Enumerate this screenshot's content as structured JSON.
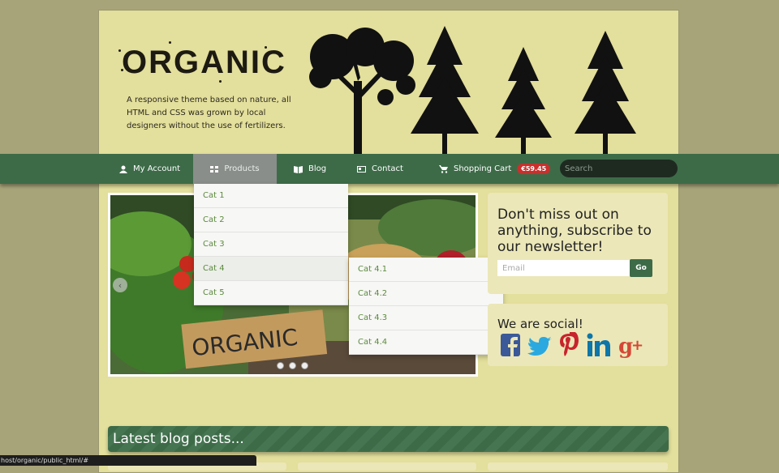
{
  "header": {
    "logo_text": "ORGANIC",
    "tagline": "A responsive theme based on nature, all HTML and CSS was grown by local designers without the use of fertilizers."
  },
  "nav": {
    "items": [
      {
        "label": "My Account",
        "icon": "user-icon"
      },
      {
        "label": "Products",
        "icon": "grid-icon"
      },
      {
        "label": "Blog",
        "icon": "book-icon"
      },
      {
        "label": "Contact",
        "icon": "card-icon"
      },
      {
        "label": "Shopping Cart",
        "icon": "cart-icon"
      }
    ],
    "cart_total": "€59.45",
    "search_placeholder": "Search"
  },
  "products_menu": [
    "Cat 1",
    "Cat 2",
    "Cat 3",
    "Cat 4",
    "Cat 5"
  ],
  "cat4_submenu": [
    "Cat 4.1",
    "Cat 4.2",
    "Cat 4.3",
    "Cat 4.4"
  ],
  "slider": {
    "sign_text": "ORGANIC"
  },
  "newsletter": {
    "title": "Don't miss out on anything, subscribe to our newsletter!",
    "email_placeholder": "Email",
    "go_label": "Go"
  },
  "social": {
    "title": "We are social!",
    "icons": [
      "facebook-icon",
      "twitter-icon",
      "pinterest-icon",
      "linkedin-icon",
      "google-plus-icon"
    ]
  },
  "blog": {
    "title": "Latest blog posts..."
  },
  "statusbar": {
    "url": "host/organic/public_html/#"
  },
  "colors": {
    "nav_green": "#3d6b48",
    "page_bg": "#e3df9c",
    "body_bg": "#a8a47a",
    "badge_red": "#c9302c",
    "menu_text": "#5b8a3d"
  }
}
